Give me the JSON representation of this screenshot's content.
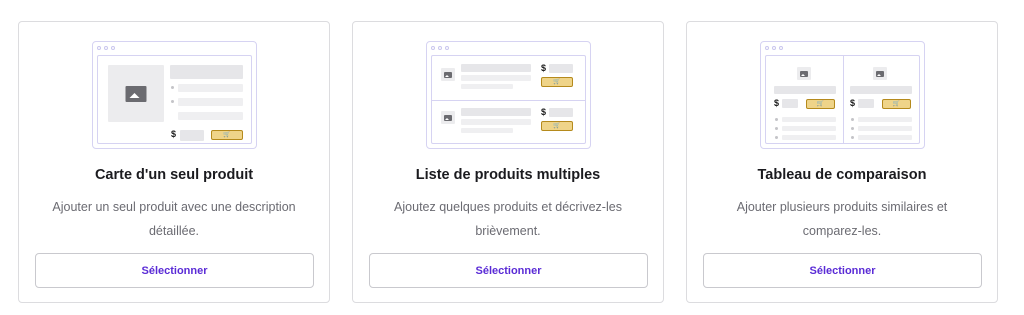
{
  "cards": [
    {
      "title": "Carte d'un seul produit",
      "description": "Ajouter un seul produit avec une description détaillée.",
      "button_label": "Sélectionner",
      "illustration": {
        "currency": "$",
        "cart_icon": "cart-icon"
      }
    },
    {
      "title": "Liste de produits multiples",
      "description": "Ajoutez quelques produits et décrivez-les brièvement.",
      "button_label": "Sélectionner",
      "illustration": {
        "currency": "$",
        "cart_icon": "cart-icon"
      }
    },
    {
      "title": "Tableau de comparaison",
      "description": "Ajouter plusieurs produits similaires et comparez-les.",
      "button_label": "Sélectionner",
      "illustration": {
        "currency": "$",
        "cart_icon": "cart-icon"
      }
    }
  ],
  "colors": {
    "accent": "#5a2bd6",
    "border": "#dcdcdf",
    "cart_button": "#efd489",
    "illustration_border": "#d6d3f2"
  }
}
